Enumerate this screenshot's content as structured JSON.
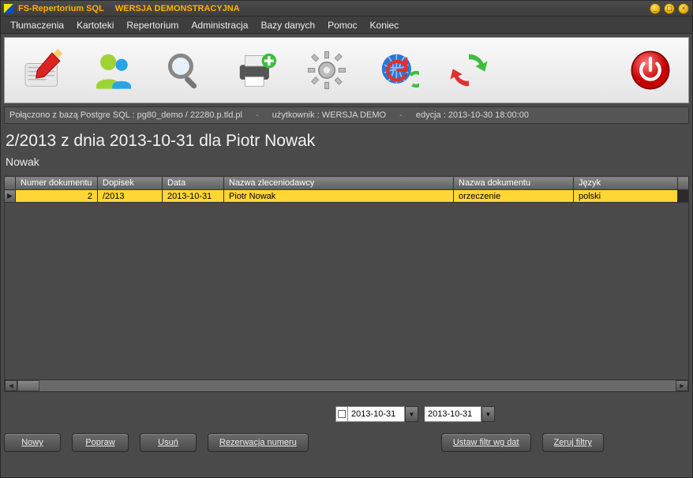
{
  "title": {
    "app": "FS-Repertorium SQL",
    "mode": "WERSJA DEMONSTRACYJNA"
  },
  "window_buttons": {
    "min": "_",
    "max": "▢",
    "close": "×"
  },
  "menu": [
    "Tłumaczenia",
    "Kartoteki",
    "Repertorium",
    "Administracja",
    "Bazy danych",
    "Pomoc",
    "Koniec"
  ],
  "toolbar_icons": {
    "edit": "edit-icon",
    "users": "users-icon",
    "search": "search-icon",
    "print": "print-add-icon",
    "gear": "gear-icon",
    "globe": "globe-refresh-icon",
    "sync": "sync-icon",
    "power": "power-icon"
  },
  "status": {
    "conn_label": "Połączono z bazą Postgre SQL  :",
    "conn_value": "pg80_demo / 22280.p.tld.pl",
    "user_label": "użytkownik :",
    "user_value": "WERSJA DEMO",
    "edition_label": "edycja :",
    "edition_value": "2013-10-30  18:00:00"
  },
  "heading": "2/2013 z dnia 2013-10-31 dla Piotr Nowak",
  "subheading": "Nowak",
  "grid": {
    "columns": [
      "Numer dokumentu",
      "Dopisek",
      "Data",
      "Nazwa zleceniodawcy",
      "Nazwa dokumentu",
      "Język"
    ],
    "rows": [
      {
        "numer": "2",
        "dopisek": "/2013",
        "data": "2013-10-31",
        "zlec": "Piotr Nowak",
        "dok": "orzeczenie",
        "jezyk": "polski"
      }
    ]
  },
  "filters": {
    "date_from": "2013-10-31",
    "date_to": "2013-10-31",
    "set_label": "Ustaw filtr wg dat",
    "clear_label": "Zeruj filtry"
  },
  "buttons": {
    "nowy": "Nowy",
    "popraw": "Popraw",
    "usun": "Usuń",
    "rezerwacja": "Rezerwacja numeru"
  }
}
